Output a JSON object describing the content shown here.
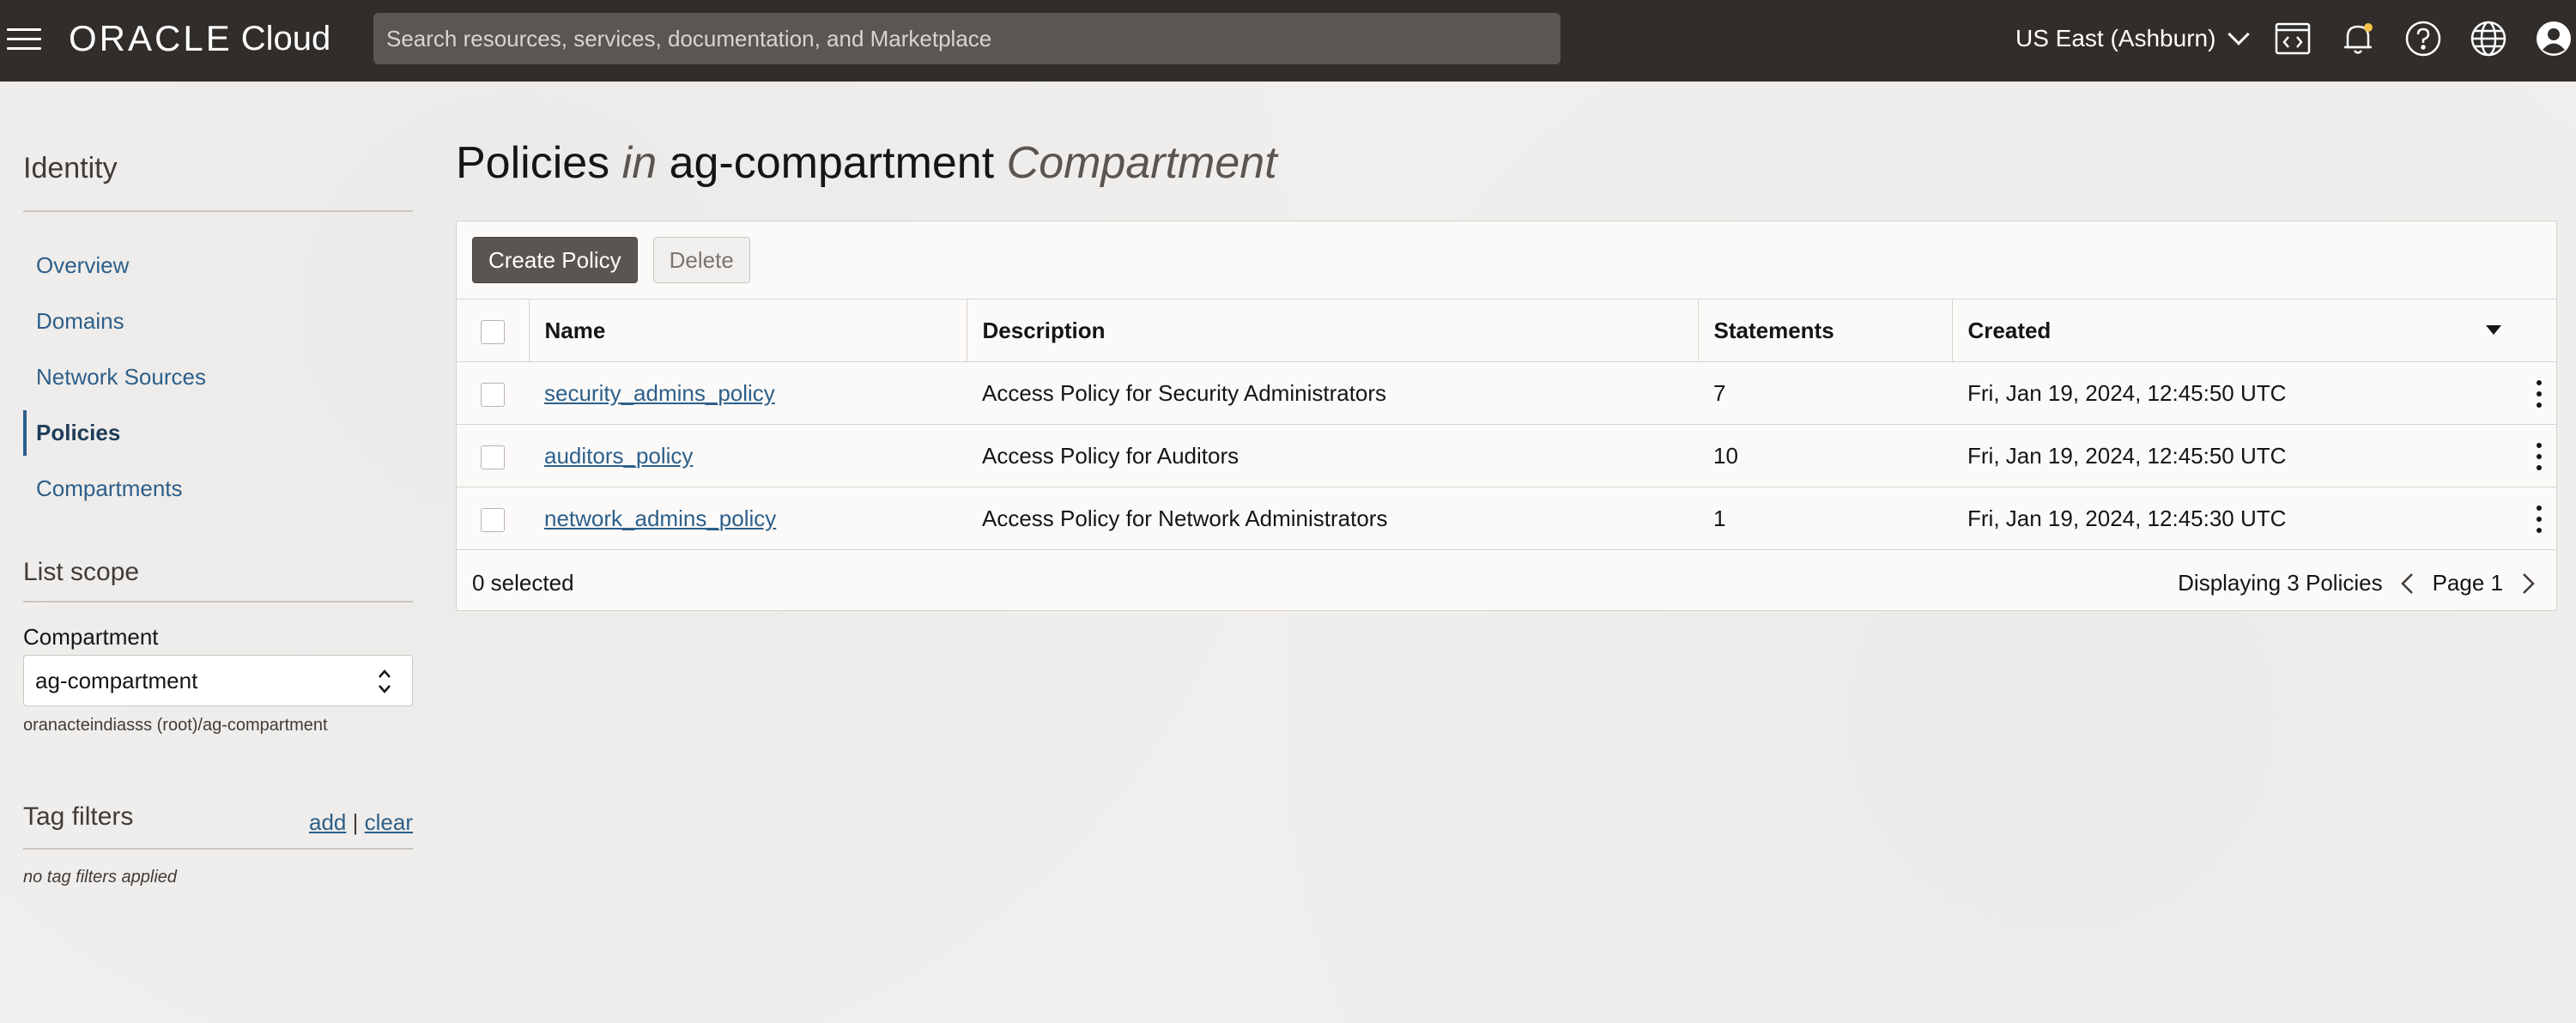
{
  "header": {
    "logo_brand": "ORACLE",
    "logo_product": "Cloud",
    "search_placeholder": "Search resources, services, documentation, and Marketplace",
    "region": "US East (Ashburn)",
    "icons": [
      "menu-icon",
      "code-editor-icon",
      "bell-icon",
      "help-icon",
      "globe-icon",
      "user-icon"
    ]
  },
  "sidebar": {
    "title": "Identity",
    "nav": [
      {
        "label": "Overview",
        "active": false
      },
      {
        "label": "Domains",
        "active": false
      },
      {
        "label": "Network Sources",
        "active": false
      },
      {
        "label": "Policies",
        "active": true
      },
      {
        "label": "Compartments",
        "active": false
      }
    ],
    "list_scope": {
      "title": "List scope",
      "compartment_label": "Compartment",
      "compartment_value": "ag-compartment",
      "compartment_path": "oranacteindiasss (root)/ag-compartment"
    },
    "tag_filters": {
      "title": "Tag filters",
      "add": "add",
      "separator": "|",
      "clear": "clear",
      "empty": "no tag filters applied"
    }
  },
  "main": {
    "title_prefix": "Policies",
    "title_in": "in",
    "title_compartment": "ag-compartment",
    "title_suffix": "Compartment",
    "toolbar": {
      "create": "Create Policy",
      "delete": "Delete"
    },
    "table": {
      "columns": [
        "Name",
        "Description",
        "Statements",
        "Created"
      ],
      "rows": [
        {
          "name": "security_admins_policy",
          "description": "Access Policy for Security Administrators",
          "statements": "7",
          "created": "Fri, Jan 19, 2024, 12:45:50 UTC"
        },
        {
          "name": "auditors_policy",
          "description": "Access Policy for Auditors",
          "statements": "10",
          "created": "Fri, Jan 19, 2024, 12:45:50 UTC"
        },
        {
          "name": "network_admins_policy",
          "description": "Access Policy for Network Administrators",
          "statements": "1",
          "created": "Fri, Jan 19, 2024, 12:45:30 UTC"
        }
      ]
    },
    "footer": {
      "selected": "0 selected",
      "displaying": "Displaying 3 Policies",
      "page": "Page 1"
    }
  },
  "colors": {
    "header_bg": "#312d2a",
    "link": "#2c5f8a",
    "primary_button": "#5a5550",
    "page_bg": "#f1efed"
  }
}
